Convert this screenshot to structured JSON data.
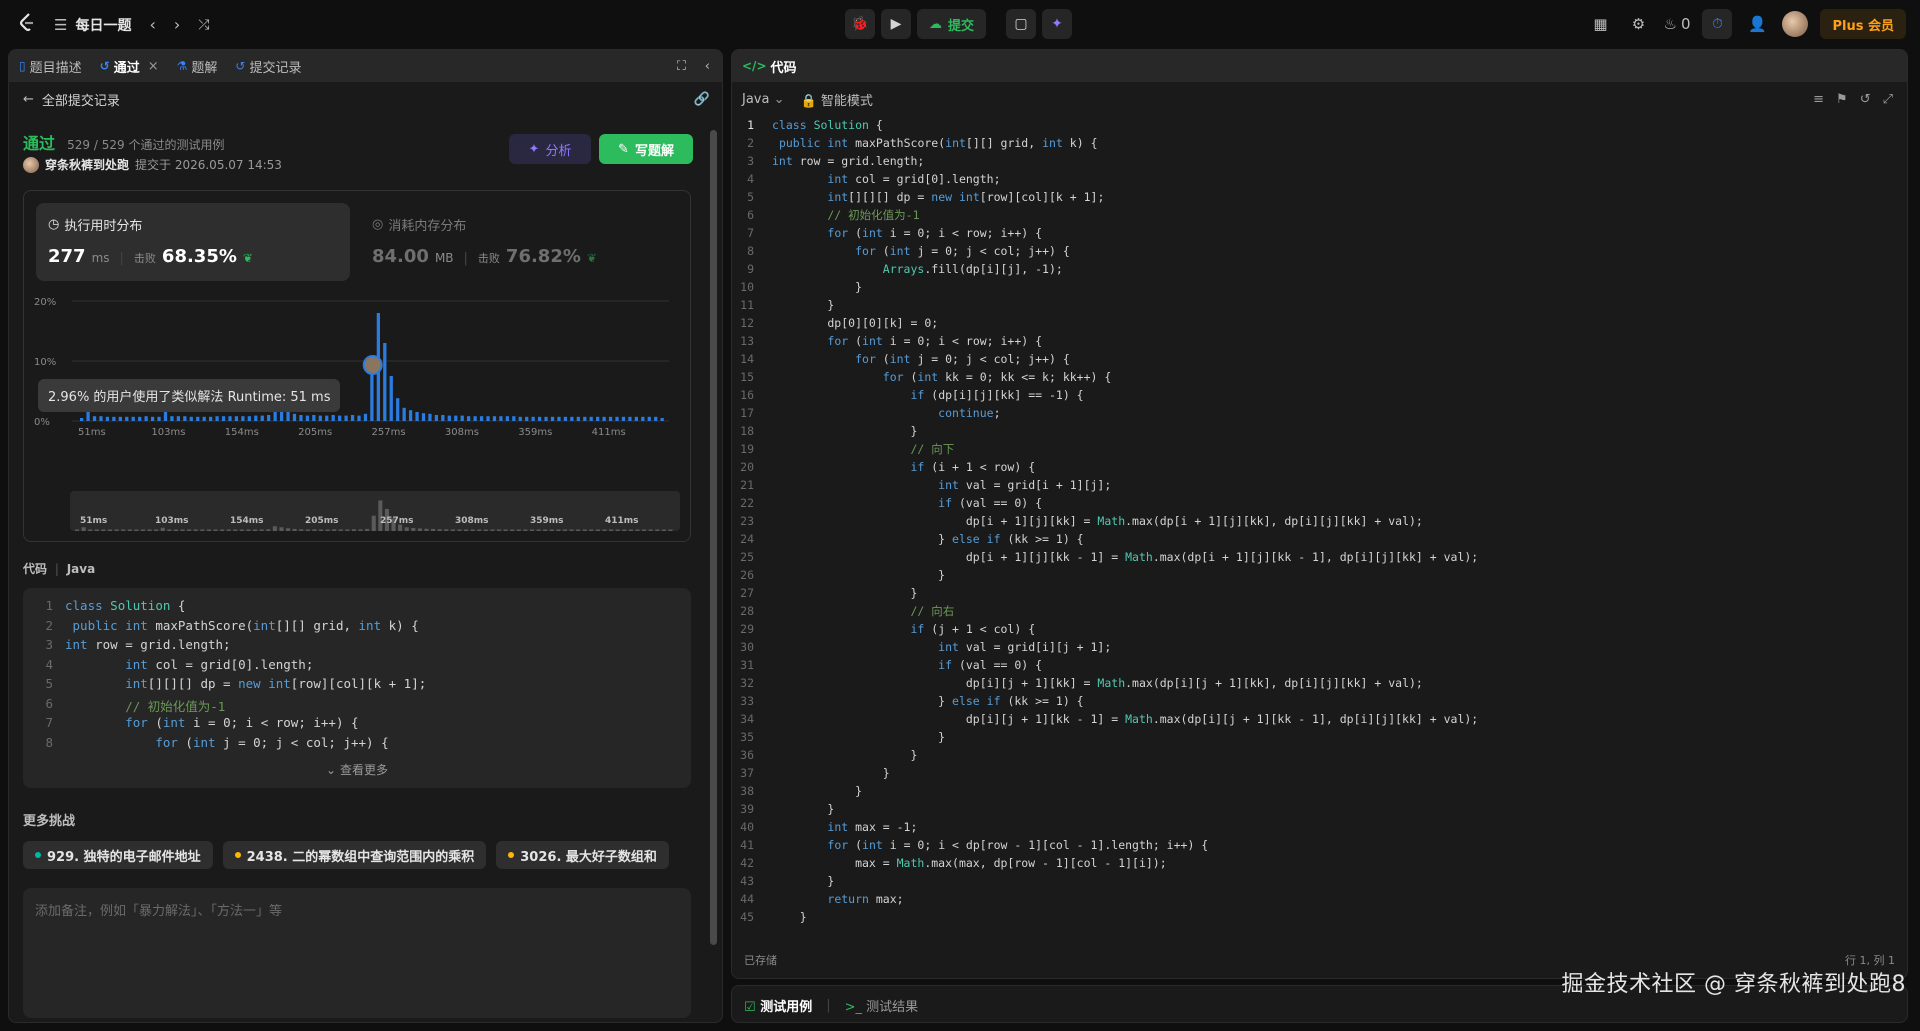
{
  "topbar": {
    "title": "每日一题",
    "submit_label": "提交",
    "fire_count": "0",
    "plus_label": "Plus 会员"
  },
  "left": {
    "tabs": [
      {
        "label": "题目描述"
      },
      {
        "label": "通过"
      },
      {
        "label": "题解"
      },
      {
        "label": "提交记录"
      }
    ],
    "back_label": "全部提交记录",
    "status": "通过",
    "cases": "529 / 529 个通过的测试用例",
    "author": "穿条秋裤到处跑",
    "submitted_at": "提交于 2026.05.07 14:53",
    "analyze_label": "分析",
    "write_label": "写题解",
    "runtime": {
      "title": "执行用时分布",
      "value": "277",
      "unit": "ms",
      "beat_label": "击败",
      "beat": "68.35%"
    },
    "memory": {
      "title": "消耗内存分布",
      "value": "84.00",
      "unit": "MB",
      "beat_label": "击败",
      "beat": "76.82%"
    },
    "tooltip": "2.96% 的用户使用了类似解法 Runtime: 51 ms",
    "code_label": "代码",
    "code_lang": "Java",
    "preview_lines": [
      "class Solution {",
      " public int maxPathScore(int[][] grid, int k) {",
      "int row = grid.length;",
      "        int col = grid[0].length;",
      "        int[][][] dp = new int[row][col][k + 1];",
      "        // 初始化值为-1",
      "        for (int i = 0; i < row; i++) {",
      "            for (int j = 0; j < col; j++) {"
    ],
    "see_more": "查看更多",
    "more_title": "更多挑战",
    "challenges": [
      {
        "label": "929. 独特的电子邮件地址",
        "color": "#00b8a3"
      },
      {
        "label": "2438. 二的幂数组中查询范围内的乘积",
        "color": "#ffb800"
      },
      {
        "label": "3026. 最大好子数组和",
        "color": "#ffb800"
      }
    ],
    "notes_placeholder": "添加备注，例如「暴力解法」、「方法一」等"
  },
  "chart_data": {
    "type": "bar",
    "title": "执行用时分布",
    "ylim": [
      0,
      20
    ],
    "yticks": [
      "20%",
      "10%",
      "0%"
    ],
    "xticks": [
      "51ms",
      "103ms",
      "154ms",
      "205ms",
      "257ms",
      "308ms",
      "359ms",
      "411ms"
    ],
    "values": [
      0.5,
      2.2,
      0.8,
      0.8,
      0.7,
      0.7,
      0.7,
      0.7,
      0.7,
      0.7,
      0.8,
      0.7,
      0.7,
      1.9,
      0.8,
      0.8,
      0.8,
      0.7,
      0.7,
      0.7,
      0.7,
      0.8,
      0.8,
      0.8,
      0.8,
      0.8,
      0.8,
      0.9,
      0.9,
      1.0,
      2.8,
      2.2,
      1.6,
      1.2,
      1.0,
      0.9,
      1.0,
      0.9,
      0.9,
      1.0,
      0.9,
      0.9,
      1.0,
      0.9,
      1.2,
      9.0,
      18.0,
      13.0,
      7.5,
      3.8,
      2.2,
      1.8,
      1.5,
      1.3,
      1.2,
      1.0,
      1.0,
      0.9,
      0.9,
      0.9,
      0.8,
      0.8,
      0.8,
      0.8,
      0.8,
      0.8,
      0.8,
      0.8,
      0.7,
      0.7,
      0.7,
      0.7,
      0.7,
      0.7,
      0.7,
      0.7,
      0.7,
      0.7,
      0.7,
      0.7,
      0.7,
      0.7,
      0.7,
      0.7,
      0.7,
      0.7,
      0.7,
      0.7,
      0.7,
      0.7,
      0.5
    ],
    "highlight_index": 46
  },
  "editor": {
    "title": "代码",
    "lang": "Java",
    "mode": "智能模式",
    "saved": "已存储",
    "position": "行 1, 列 1",
    "lines": [
      "class Solution {",
      " public int maxPathScore(int[][] grid, int k) {",
      "int row = grid.length;",
      "        int col = grid[0].length;",
      "        int[][][] dp = new int[row][col][k + 1];",
      "        // 初始化值为-1",
      "        for (int i = 0; i < row; i++) {",
      "            for (int j = 0; j < col; j++) {",
      "                Arrays.fill(dp[i][j], -1);",
      "            }",
      "        }",
      "        dp[0][0][k] = 0;",
      "        for (int i = 0; i < row; i++) {",
      "            for (int j = 0; j < col; j++) {",
      "                for (int kk = 0; kk <= k; kk++) {",
      "                    if (dp[i][j][kk] == -1) {",
      "                        continue;",
      "                    }",
      "                    // 向下",
      "                    if (i + 1 < row) {",
      "                        int val = grid[i + 1][j];",
      "                        if (val == 0) {",
      "                            dp[i + 1][j][kk] = Math.max(dp[i + 1][j][kk], dp[i][j][kk] + val);",
      "                        } else if (kk >= 1) {",
      "                            dp[i + 1][j][kk - 1] = Math.max(dp[i + 1][j][kk - 1], dp[i][j][kk] + val);",
      "                        }",
      "                    }",
      "                    // 向右",
      "                    if (j + 1 < col) {",
      "                        int val = grid[i][j + 1];",
      "                        if (val == 0) {",
      "                            dp[i][j + 1][kk] = Math.max(dp[i][j + 1][kk], dp[i][j][kk] + val);",
      "                        } else if (kk >= 1) {",
      "                            dp[i][j + 1][kk - 1] = Math.max(dp[i][j + 1][kk - 1], dp[i][j][kk] + val);",
      "                        }",
      "                    }",
      "                }",
      "            }",
      "        }",
      "        int max = -1;",
      "        for (int i = 0; i < dp[row - 1][col - 1].length; i++) {",
      "            max = Math.max(max, dp[row - 1][col - 1][i]);",
      "        }",
      "        return max;",
      "    }"
    ]
  },
  "bottom": {
    "tab1": "测试用例",
    "tab2": "测试结果"
  },
  "watermark": "掘金技术社区 @ 穿条秋裤到处跑8"
}
